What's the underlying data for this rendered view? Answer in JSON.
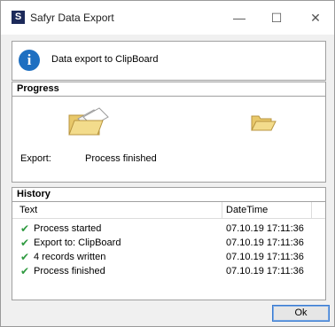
{
  "window": {
    "title": "Safyr Data Export",
    "app_icon_letter": "S"
  },
  "controls": {
    "minimize": "—",
    "maximize": "☐",
    "close": "✕"
  },
  "info": {
    "text": "Data export to ClipBoard",
    "icon": "info-icon"
  },
  "progress": {
    "header": "Progress",
    "export_label": "Export:",
    "status": "Process finished",
    "source_icon": "folder-with-papers-icon",
    "target_icon": "open-folder-icon"
  },
  "history": {
    "header": "History",
    "columns": {
      "text": "Text",
      "datetime": "DateTime"
    },
    "rows": [
      {
        "text": "Process started",
        "datetime": "07.10.19 17:11:36",
        "icon": "check-icon"
      },
      {
        "text": "Export to: ClipBoard",
        "datetime": "07.10.19 17:11:36",
        "icon": "check-icon"
      },
      {
        "text": "4 records written",
        "datetime": "07.10.19 17:11:36",
        "icon": "check-icon"
      },
      {
        "text": "Process finished",
        "datetime": "07.10.19 17:11:36",
        "icon": "check-icon"
      }
    ]
  },
  "buttons": {
    "ok": "Ok"
  },
  "colors": {
    "accent": "#1e6fc1",
    "check": "#2f9a40",
    "folder": "#f3dc8c"
  }
}
